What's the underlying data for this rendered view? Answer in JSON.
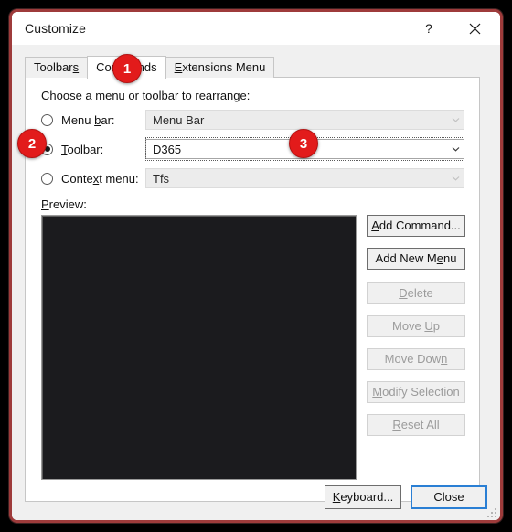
{
  "window": {
    "title": "Customize",
    "help_icon": "question-mark-icon",
    "help_label": "?",
    "close_icon": "close-icon",
    "frame_border_color": "#9e3b3b",
    "backdrop_color": "#000000"
  },
  "tabs": [
    {
      "label": "Toolbars",
      "selected": false
    },
    {
      "label": "Commands",
      "selected": true
    },
    {
      "label": "Extensions Menu",
      "selected": false
    }
  ],
  "content": {
    "choose_label": "Choose a menu or toolbar to rearrange:",
    "preview_label": "Preview:"
  },
  "options": [
    {
      "id": "menu-bar",
      "label": "Menu bar:",
      "selected": false,
      "combo_value": "Menu Bar",
      "combo_enabled": false,
      "focused": false
    },
    {
      "id": "toolbar",
      "label": "Toolbar:",
      "selected": true,
      "combo_value": "D365",
      "combo_enabled": true,
      "focused": true
    },
    {
      "id": "context-menu",
      "label": "Context menu:",
      "selected": false,
      "combo_value": "Tfs",
      "combo_enabled": false,
      "focused": false
    }
  ],
  "preview": {
    "background_color": "#1b1b1e",
    "contents": ""
  },
  "side_buttons": [
    {
      "label": "Add Command...",
      "enabled": true
    },
    {
      "label": "Add New Menu",
      "enabled": true
    },
    {
      "label": "Delete",
      "enabled": false
    },
    {
      "label": "Move Up",
      "enabled": false
    },
    {
      "label": "Move Down",
      "enabled": false
    },
    {
      "label": "Modify Selection",
      "enabled": false
    },
    {
      "label": "Reset All",
      "enabled": false
    }
  ],
  "footer": {
    "keyboard_label": "Keyboard...",
    "close_label": "Close",
    "focus_color": "#2a7fd4"
  },
  "callouts": [
    {
      "number": "1",
      "target": "tab-commands"
    },
    {
      "number": "2",
      "target": "radio-toolbar"
    },
    {
      "number": "3",
      "target": "combo-toolbar"
    }
  ]
}
